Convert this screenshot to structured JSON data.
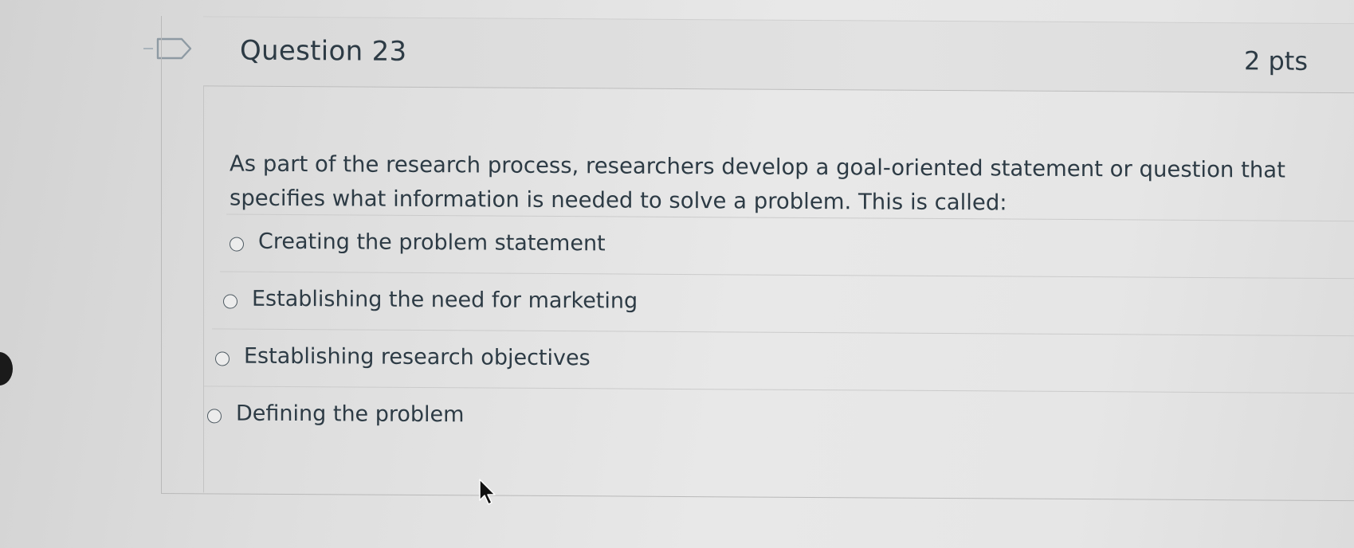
{
  "question": {
    "title": "Question 23",
    "points": "2 pts",
    "text": "As part of the research process, researchers develop a goal-oriented statement or question that specifies what information is needed to solve a problem. This is called:",
    "answers": [
      {
        "label": "Creating the problem statement",
        "selected": false
      },
      {
        "label": "Establishing the need for marketing",
        "selected": false
      },
      {
        "label": "Establishing research objectives",
        "selected": false
      },
      {
        "label": "Defining the problem",
        "selected": false
      }
    ]
  },
  "icons": {
    "flag": "bookmark-flag-icon",
    "cursor": "mouse-pointer-icon"
  },
  "colors": {
    "text": "#2d3b45",
    "border": "#b9b9b9",
    "header_bg": "#dcdcdc"
  }
}
